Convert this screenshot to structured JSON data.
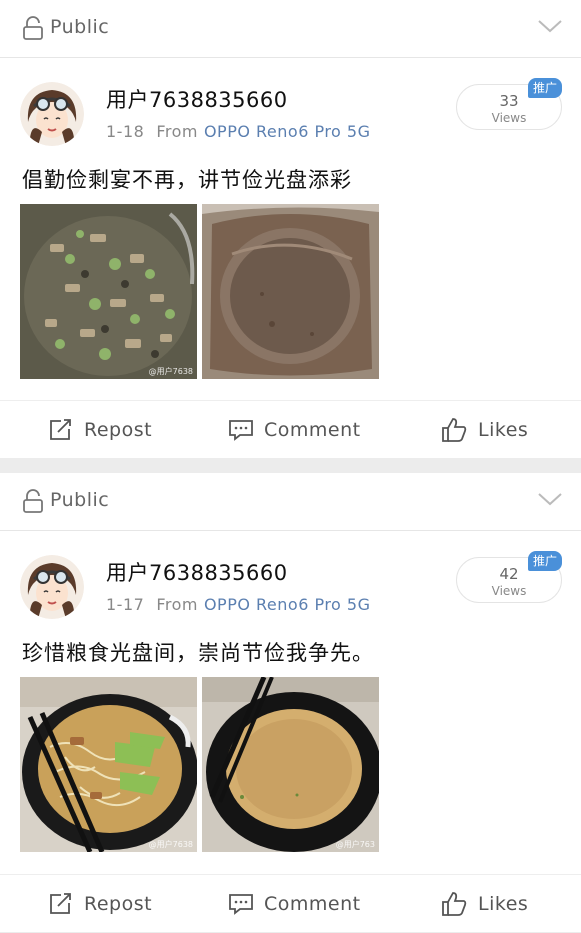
{
  "posts": [
    {
      "visibility": "Public",
      "username": "用户7638835660",
      "date": "1-18",
      "from_label": "From",
      "device": "OPPO Reno6 Pro 5G",
      "views_count": "33",
      "views_label": "Views",
      "promo_badge": "推广",
      "text": "倡勤俭剩宴不再，讲节俭光盘添彩",
      "images": [
        {
          "icon": "food-photo-icon",
          "watermark": "@用户7638"
        },
        {
          "icon": "empty-plate-photo-icon",
          "watermark": ""
        }
      ],
      "actions": {
        "repost": "Repost",
        "comment": "Comment",
        "likes": "Likes"
      }
    },
    {
      "visibility": "Public",
      "username": "用户7638835660",
      "date": "1-17",
      "from_label": "From",
      "device": "OPPO Reno6 Pro 5G",
      "views_count": "42",
      "views_label": "Views",
      "promo_badge": "推广",
      "text": "珍惜粮食光盘间，崇尚节俭我争先。",
      "images": [
        {
          "icon": "noodle-bowl-photo-icon",
          "watermark": "@用户7638"
        },
        {
          "icon": "empty-bowl-photo-icon",
          "watermark": "@用户763"
        }
      ],
      "actions": {
        "repost": "Repost",
        "comment": "Comment",
        "likes": "Likes"
      }
    }
  ],
  "colors": {
    "device_link": "#5b7fb0",
    "promo_badge": "#4a90d9",
    "separator": "#ececec"
  }
}
